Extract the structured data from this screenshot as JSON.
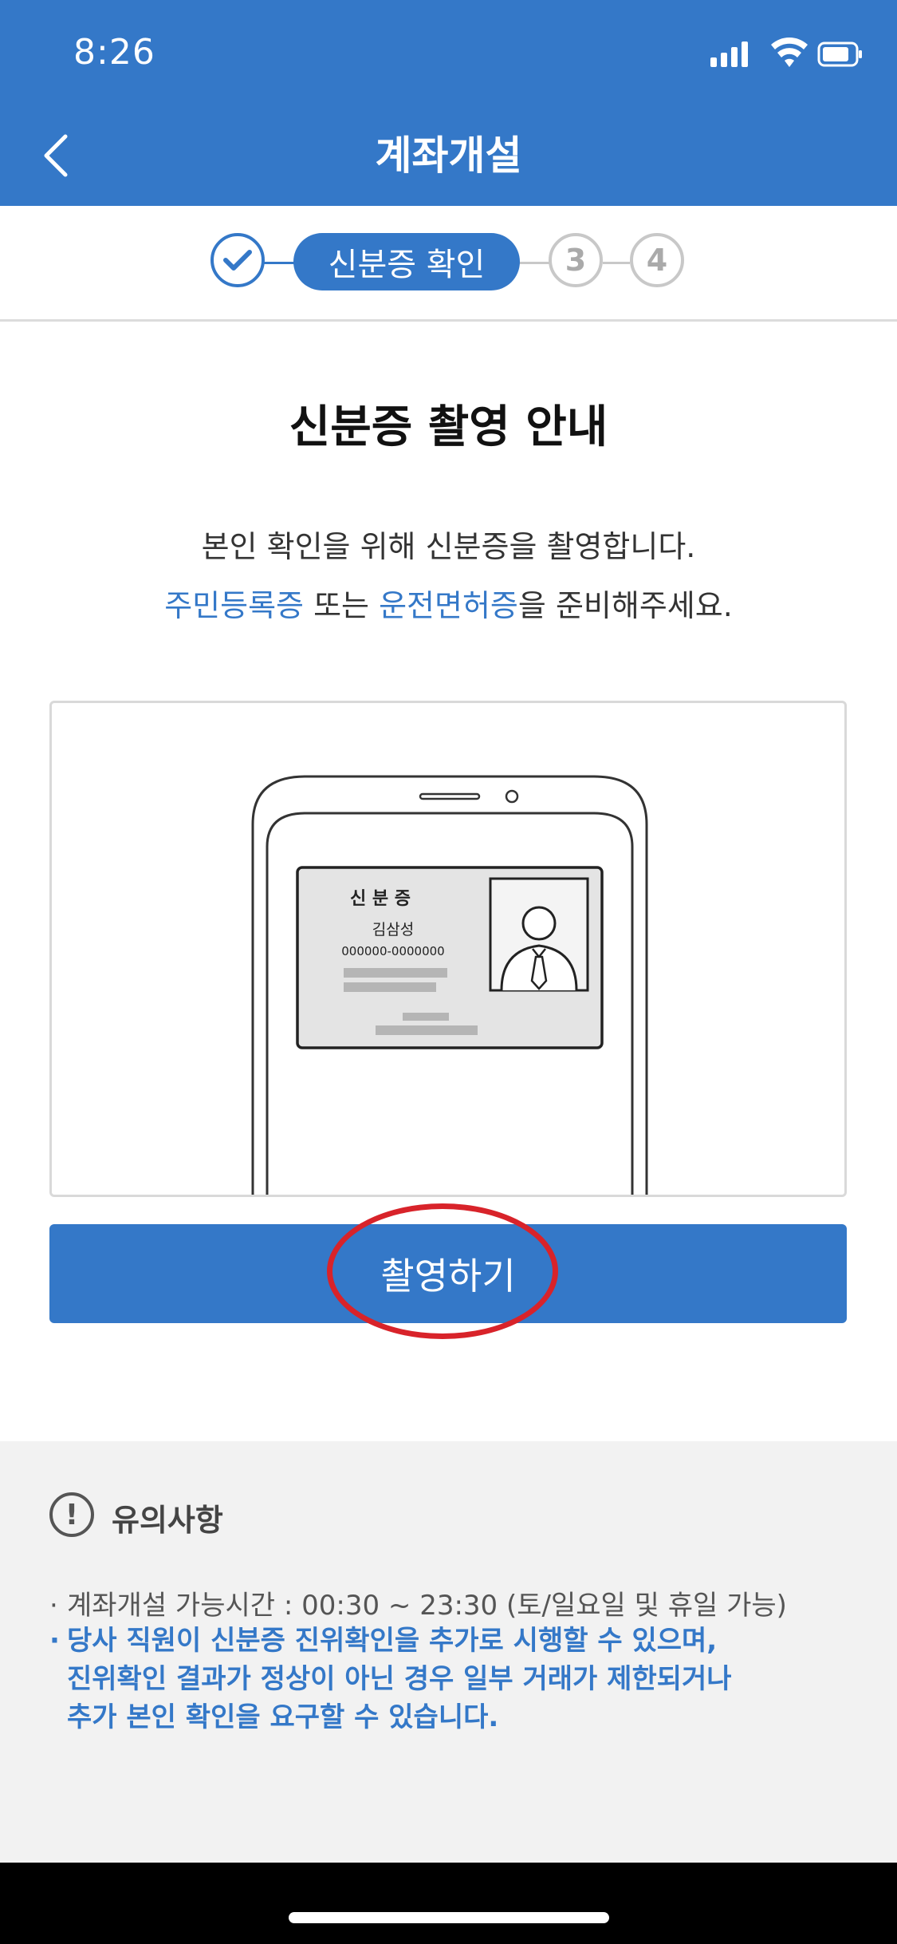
{
  "status_bar": {
    "time": "8:26"
  },
  "header": {
    "title": "계좌개설"
  },
  "stepper": {
    "active_label": "신분증 확인",
    "step3": "3",
    "step4": "4"
  },
  "main": {
    "title": "신분증 촬영 안내",
    "desc_line1": "본인 확인을 위해 신분증을 촬영합니다.",
    "desc_line2": {
      "link1": "주민등록증",
      "sep": " 또는 ",
      "link2": "운전면허증",
      "tail": "을 준비해주세요."
    }
  },
  "id_card": {
    "title": "신 분 증",
    "name": "김삼성",
    "number": "000000-0000000"
  },
  "action": {
    "shoot_label": "촬영하기"
  },
  "notice": {
    "icon": "!",
    "title": "유의사항",
    "bullet": "·",
    "items": [
      "계좌개설 가능시간 : 00:30 ~ 23:30 (토/일요일 및 휴일 가능)",
      "당사 직원이 신분증 진위확인을 추가로 시행할 수 있으며,\n진위확인 결과가 정상이 아닌 경우 일부 거래가 제한되거나\n추가 본인 확인을 요구할 수 있습니다."
    ]
  },
  "colors": {
    "primary": "#3478c8",
    "highlight": "#d8232a"
  }
}
